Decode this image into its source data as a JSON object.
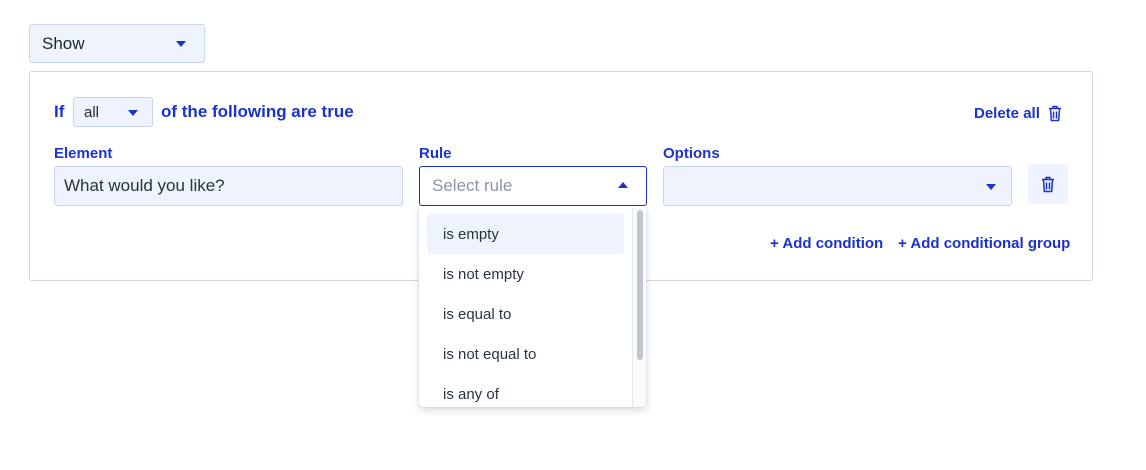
{
  "visibility": {
    "selected": "Show"
  },
  "condition": {
    "if_label": "If",
    "match_selected": "all",
    "following_label": "of the following are true",
    "delete_all_label": "Delete all",
    "columns": {
      "element": "Element",
      "rule": "Rule",
      "options": "Options"
    },
    "element_value": "What would you like?",
    "rule_placeholder": "Select rule",
    "options_value": "",
    "add_condition_label": "+ Add condition",
    "add_group_label": "+ Add conditional group"
  },
  "rule_menu": {
    "items": [
      {
        "label": "is empty"
      },
      {
        "label": "is not empty"
      },
      {
        "label": "is equal to"
      },
      {
        "label": "is not equal to"
      },
      {
        "label": "is any of"
      }
    ],
    "highlighted_index": 0
  },
  "colors": {
    "accent": "#1b33c9",
    "field_bg": "#eef3fd",
    "border": "#c9d6ee"
  },
  "icons": {
    "delete_all": "trash-icon",
    "row_delete": "trash-icon",
    "dropdown": "caret-down-icon",
    "dropdown_open": "caret-up-icon"
  }
}
